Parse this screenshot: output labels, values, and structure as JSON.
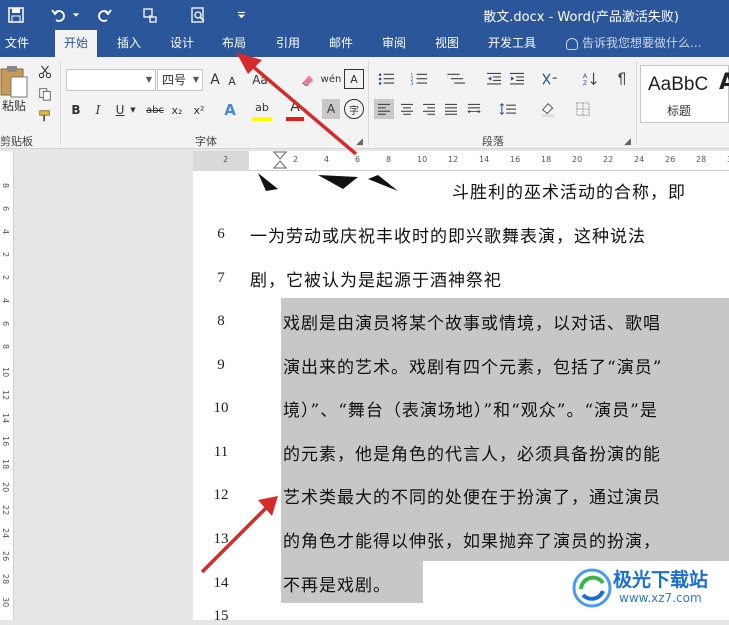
{
  "window": {
    "title": "散文.docx - Word(产品激活失败)"
  },
  "tabs": [
    {
      "label": "文件",
      "active": false
    },
    {
      "label": "开始",
      "active": true
    },
    {
      "label": "插入",
      "active": false
    },
    {
      "label": "设计",
      "active": false
    },
    {
      "label": "布局",
      "active": false
    },
    {
      "label": "引用",
      "active": false
    },
    {
      "label": "邮件",
      "active": false
    },
    {
      "label": "审阅",
      "active": false
    },
    {
      "label": "视图",
      "active": false
    },
    {
      "label": "开发工具",
      "active": false
    }
  ],
  "tellme": {
    "placeholder": "告诉我您想要做什么..."
  },
  "ribbon": {
    "clipboard": {
      "paste_label": "粘贴",
      "group_label": "剪贴板"
    },
    "font": {
      "font_name": "",
      "font_size": "四号",
      "group_label": "字体",
      "bold": "B",
      "italic": "I",
      "underline": "U",
      "strike": "abc",
      "sub": "x₂",
      "sup": "x²",
      "grow": "A",
      "shrink": "A",
      "aa": "Aa",
      "phonetic": "wén",
      "char_border": "A",
      "effects": "A",
      "highlight": "ab",
      "color": "A",
      "shade": "A",
      "enclose": "字"
    },
    "paragraph": {
      "group_label": "段落"
    },
    "styles": {
      "preview": "AaBbC",
      "name": "标题",
      "preview2": "A"
    }
  },
  "ruler": {
    "numbers": [
      "2",
      "2",
      "4",
      "6",
      "8",
      "10",
      "12",
      "14",
      "16",
      "18",
      "20",
      "22",
      "24",
      "26",
      "28",
      "30"
    ]
  },
  "vruler": {
    "numbers": [
      "8",
      "6",
      "4",
      "2",
      "2",
      "4",
      "6",
      "8",
      "10",
      "12",
      "14",
      "16",
      "18",
      "20",
      "22",
      "24",
      "26",
      "28",
      "30"
    ]
  },
  "document": {
    "lines": [
      {
        "num": "",
        "text": "斗胜利的巫术活动的合称，即"
      },
      {
        "num": "6",
        "text": "一为劳动或庆祝丰收时的即兴歌舞表演，这种说法"
      },
      {
        "num": "7",
        "text": "剧，它被认为是起源于酒神祭祀"
      },
      {
        "num": "8",
        "text": "戏剧是由演员将某个故事或情境，以对话、歌唱"
      },
      {
        "num": "9",
        "text": "演出来的艺术。戏剧有四个元素，包括了“演员”"
      },
      {
        "num": "10",
        "text": "境）”、“舞台（表演场地）”和“观众”。“演员”是"
      },
      {
        "num": "11",
        "text": "的元素，他是角色的代言人，必须具备扮演的能"
      },
      {
        "num": "12",
        "text": "艺术类最大的不同的处便在于扮演了，通过演员"
      },
      {
        "num": "13",
        "text": "的角色才能得以伸张，如果抛弃了演员的扮演，"
      },
      {
        "num": "14",
        "text": "不再是戏剧。"
      },
      {
        "num": "15",
        "text": ""
      }
    ]
  },
  "watermark": {
    "name": "极光下载站",
    "url": "www.xz7.com"
  },
  "colors": {
    "accent": "#2b579a",
    "selection": "#c7c7c7",
    "arrow": "#d42b2b"
  }
}
